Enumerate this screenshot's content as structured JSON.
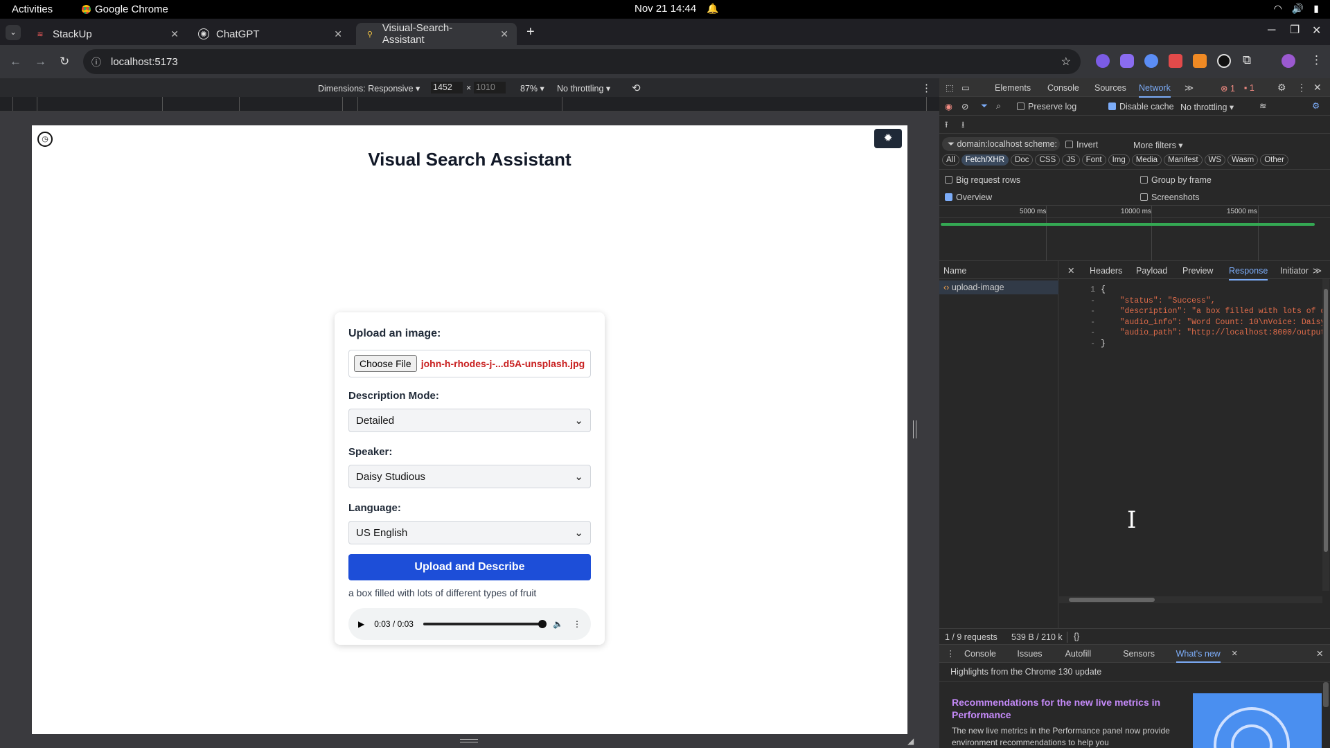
{
  "os_bar": {
    "activities": "Activities",
    "app_name": "Google Chrome",
    "clock": "Nov 21  14:44"
  },
  "tabs": [
    {
      "label": "StackUp",
      "active": false
    },
    {
      "label": "ChatGPT",
      "active": false
    },
    {
      "label": "Visiual-Search-Assistant",
      "active": true
    }
  ],
  "address": {
    "url": "localhost:5173"
  },
  "device_toolbar": {
    "dimensions": "Dimensions: Responsive",
    "width": "1452",
    "height": "1010",
    "zoom": "87%",
    "throttling": "No throttling"
  },
  "page": {
    "title": "Visual Search Assistant",
    "upload_label": "Upload an image:",
    "choose_file": "Choose File",
    "file_name": "john-h-rhodes-j-...d5A-unsplash.jpg",
    "mode_label": "Description Mode:",
    "mode_value": "Detailed",
    "speaker_label": "Speaker:",
    "speaker_value": "Daisy Studious",
    "language_label": "Language:",
    "language_value": "US English",
    "submit_label": "Upload and Describe",
    "result_text": "a box filled with lots of different types of fruit",
    "audio_time": "0:03 / 0:03",
    "audio_progress": 1.0
  },
  "devtools": {
    "tabs": [
      "Elements",
      "Console",
      "Sources",
      "Network"
    ],
    "active_tab": "Network",
    "error_count": "1",
    "issue_count": "1",
    "preserve_log": "Preserve log",
    "disable_cache": "Disable cache",
    "throttle": "No throttling",
    "filter_text": "domain:localhost scheme:",
    "invert": "Invert",
    "more_filters": "More filters",
    "type_filters": [
      "All",
      "Fetch/XHR",
      "Doc",
      "CSS",
      "JS",
      "Font",
      "Img",
      "Media",
      "Manifest",
      "WS",
      "Wasm",
      "Other"
    ],
    "active_filter": "Fetch/XHR",
    "big_rows": "Big request rows",
    "group_by_frame": "Group by frame",
    "overview": "Overview",
    "screenshots": "Screenshots",
    "timeline_ticks": [
      "5000 ms",
      "10000 ms",
      "15000 ms"
    ],
    "name_header": "Name",
    "request_name": "upload-image",
    "detail_tabs": [
      "Headers",
      "Payload",
      "Preview",
      "Response",
      "Initiator"
    ],
    "active_detail": "Response",
    "response_lines": [
      "{",
      "    \"status\": \"Success\",",
      "    \"description\": \"a box filled with lots of di",
      "    \"audio_info\": \"Word Count: 10\\nVoice: Daisy",
      "    \"audio_path\": \"http://localhost:8000/output_",
      "}"
    ],
    "line_gutter": [
      "1",
      "-",
      "-",
      "-",
      "-",
      "-"
    ],
    "requests_summary": "1 / 9 requests",
    "size_summary": "539 B / 210 k",
    "drawer_tabs": [
      "Console",
      "Issues",
      "Autofill",
      "Sensors",
      "What's new"
    ],
    "active_drawer": "What's new",
    "highlights": "Highlights from the Chrome 130 update",
    "whatsnew_title": "Recommendations for the new live metrics in Performance",
    "whatsnew_body": "The new live metrics in the Performance panel now provide environment recommendations to help you"
  },
  "colors": {
    "primary_button": "#1d4ed8",
    "file_name": "#c81e1e",
    "devtools_accent": "#7cacf8"
  }
}
